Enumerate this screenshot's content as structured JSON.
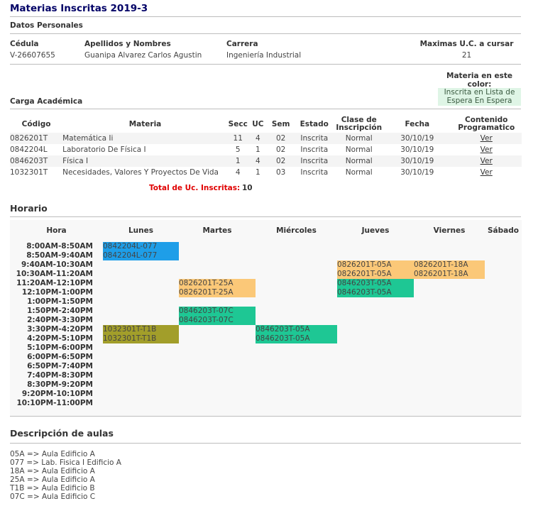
{
  "page": {
    "title": "Materias Inscritas 2019-3"
  },
  "personal": {
    "section": "Datos Personales",
    "cedula_label": "Cédula",
    "cedula": "V-26607655",
    "nombre_label": "Apellidos y Nombres",
    "nombre": "Guanipa Alvarez Carlos Agustin",
    "carrera_label": "Carrera",
    "carrera": "Ingeniería Industrial",
    "uc_label": "Maximas U.C. a cursar",
    "uc": "21"
  },
  "legend": {
    "title_line1": "Materia en este",
    "title_line2": "color:",
    "box_line1": "Inscrita en Lista de",
    "box_line2": "Espera En Espera",
    "color": "#dff5e6"
  },
  "carga": {
    "section": "Carga Académica",
    "headers": {
      "codigo": "Código",
      "materia": "Materia",
      "secc": "Secc",
      "uc": "UC",
      "sem": "Sem",
      "estado": "Estado",
      "clase1": "Clase de",
      "clase2": "Inscripción",
      "fecha": "Fecha",
      "contenido1": "Contenido",
      "contenido2": "Programatico"
    },
    "rows": [
      {
        "codigo": "0826201T",
        "materia": "Matemática Ii",
        "secc": "11",
        "uc": "4",
        "sem": "02",
        "estado": "Inscrita",
        "clase": "Normal",
        "fecha": "30/10/19",
        "link": "Ver"
      },
      {
        "codigo": "0842204L",
        "materia": "Laboratorio De Física I",
        "secc": "5",
        "uc": "1",
        "sem": "02",
        "estado": "Inscrita",
        "clase": "Normal",
        "fecha": "30/10/19",
        "link": "Ver"
      },
      {
        "codigo": "0846203T",
        "materia": "Física I",
        "secc": "1",
        "uc": "4",
        "sem": "02",
        "estado": "Inscrita",
        "clase": "Normal",
        "fecha": "30/10/19",
        "link": "Ver"
      },
      {
        "codigo": "1032301T",
        "materia": "Necesidades, Valores Y Proyectos De Vida",
        "secc": "4",
        "uc": "1",
        "sem": "03",
        "estado": "Inscrita",
        "clase": "Normal",
        "fecha": "30/10/19",
        "link": "Ver"
      }
    ],
    "total_label": "Total de Uc. Inscritas:",
    "total": "10"
  },
  "horario": {
    "section": "Horario",
    "days": [
      "Hora",
      "Lunes",
      "Martes",
      "Miércoles",
      "Jueves",
      "Viernes",
      "Sábado"
    ],
    "slots": [
      "8:00AM-8:50AM",
      "8:50AM-9:40AM",
      "9:40AM-10:30AM",
      "10:30AM-11:20AM",
      "11:20AM-12:10PM",
      "12:10PM-1:00PM",
      "1:00PM-1:50PM",
      "1:50PM-2:40PM",
      "2:40PM-3:30PM",
      "3:30PM-4:20PM",
      "4:20PM-5:10PM",
      "5:10PM-6:00PM",
      "6:00PM-6:50PM",
      "6:50PM-7:40PM",
      "7:40PM-8:30PM",
      "8:30PM-9:20PM",
      "9:20PM-10:10PM",
      "10:10PM-11:00PM"
    ],
    "blocks": [
      {
        "slot": 0,
        "day": 1,
        "text": "0842204L-077",
        "color": "#1e9ee8"
      },
      {
        "slot": 1,
        "day": 1,
        "text": "0842204L-077",
        "color": "#1e9ee8"
      },
      {
        "slot": 2,
        "day": 4,
        "text": "0826201T-05A",
        "color": "#fbc878"
      },
      {
        "slot": 2,
        "day": 5,
        "text": "0826201T-18A",
        "color": "#fbc878"
      },
      {
        "slot": 3,
        "day": 4,
        "text": "0826201T-05A",
        "color": "#fbc878"
      },
      {
        "slot": 3,
        "day": 5,
        "text": "0826201T-18A",
        "color": "#fbc878"
      },
      {
        "slot": 4,
        "day": 2,
        "text": "0826201T-25A",
        "color": "#fbc878"
      },
      {
        "slot": 4,
        "day": 4,
        "text": "0846203T-05A",
        "color": "#1ec794"
      },
      {
        "slot": 5,
        "day": 2,
        "text": "0826201T-25A",
        "color": "#fbc878"
      },
      {
        "slot": 5,
        "day": 4,
        "text": "0846203T-05A",
        "color": "#1ec794"
      },
      {
        "slot": 7,
        "day": 2,
        "text": "0846203T-07C",
        "color": "#1ec794"
      },
      {
        "slot": 8,
        "day": 2,
        "text": "0846203T-07C",
        "color": "#1ec794"
      },
      {
        "slot": 9,
        "day": 1,
        "text": "1032301T-T1B",
        "color": "#a29e2a"
      },
      {
        "slot": 9,
        "day": 3,
        "text": "0846203T-05A",
        "color": "#1ec794"
      },
      {
        "slot": 10,
        "day": 1,
        "text": "1032301T-T1B",
        "color": "#a29e2a"
      },
      {
        "slot": 10,
        "day": 3,
        "text": "0846203T-05A",
        "color": "#1ec794"
      }
    ]
  },
  "aulas": {
    "section": "Descripción de aulas",
    "lines": [
      "05A => Aula Edificio A",
      "077 => Lab. Fisica I Edificio A",
      "18A => Aula Edificio A",
      "25A => Aula Edificio A",
      "T1B => Aula Edificio B",
      "07C => Aula Edificio C"
    ]
  }
}
